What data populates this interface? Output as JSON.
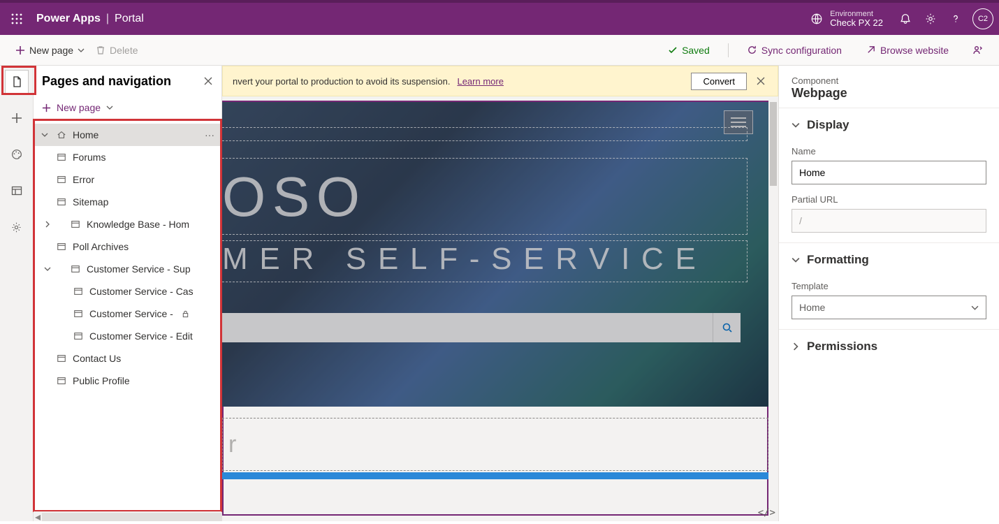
{
  "suite": {
    "app": "Power Apps",
    "area": "Portal",
    "env_label": "Environment",
    "env_value": "Check PX 22",
    "avatar": "C2"
  },
  "commands": {
    "new_page": "New page",
    "delete": "Delete",
    "saved": "Saved",
    "sync": "Sync configuration",
    "browse": "Browse website"
  },
  "pages_panel": {
    "title": "Pages and navigation",
    "new_page": "New page",
    "tree": {
      "home": "Home",
      "forums": "Forums",
      "error": "Error",
      "sitemap": "Sitemap",
      "kb": "Knowledge Base - Hom",
      "polls": "Poll Archives",
      "cs_sup": "Customer Service - Sup",
      "cs_cas": "Customer Service - Cas",
      "cs_lock": "Customer Service - ",
      "cs_edit": "Customer Service - Edit",
      "contact": "Contact Us",
      "profile": "Public Profile"
    }
  },
  "warn": {
    "text": "nvert your portal to production to avoid its suspension.",
    "learn": "Learn more",
    "convert": "Convert"
  },
  "hero": {
    "title1": "OSO",
    "title2": "MER SELF-SERVICE",
    "search_placeholder": "",
    "section2_placeholder": "r"
  },
  "props": {
    "component_lbl": "Component",
    "component_val": "Webpage",
    "display": "Display",
    "name_lbl": "Name",
    "name_val": "Home",
    "purl_lbl": "Partial URL",
    "purl_val": "/",
    "formatting": "Formatting",
    "template_lbl": "Template",
    "template_val": "Home",
    "permissions": "Permissions"
  }
}
